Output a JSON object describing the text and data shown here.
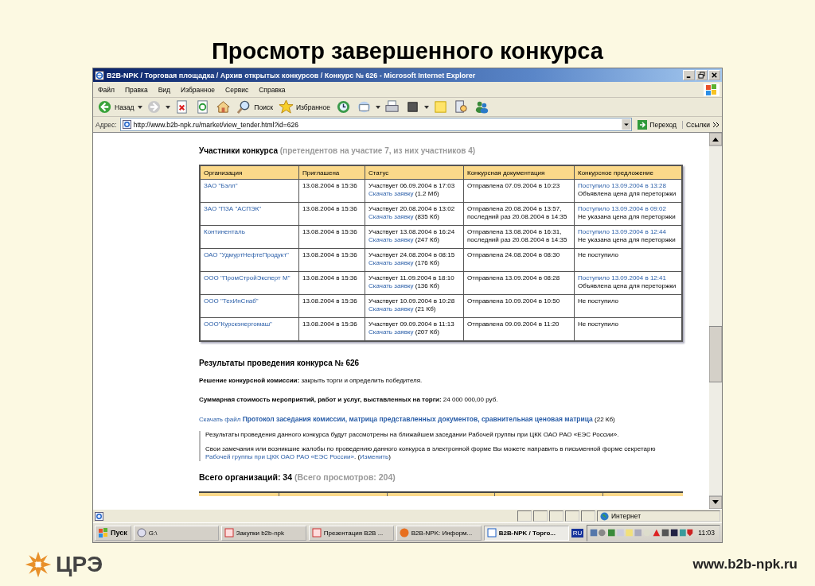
{
  "slide": {
    "title": "Просмотр завершенного конкурса",
    "logo_text": "ЦРЭ",
    "url": "www.b2b-npk.ru"
  },
  "browser": {
    "title": "B2B-NPK / Торговая площадка / Архив открытых конкурсов / Конкурс № 626 - Microsoft Internet Explorer",
    "menu": [
      "Файл",
      "Правка",
      "Вид",
      "Избранное",
      "Сервис",
      "Справка"
    ],
    "toolbar": [
      {
        "kind": "back",
        "label": "Назад",
        "dropdown": true
      },
      {
        "kind": "forward",
        "dropdown": true
      },
      {
        "kind": "stop",
        "dropdown": false
      },
      {
        "kind": "refresh",
        "dropdown": false
      },
      {
        "kind": "home",
        "dropdown": false
      },
      {
        "kind": "search",
        "label": "Поиск",
        "dropdown": false
      },
      {
        "kind": "favorites",
        "label": "Избранное",
        "dropdown": false
      },
      {
        "kind": "history",
        "dropdown": false
      },
      {
        "kind": "mail",
        "dropdown": true
      },
      {
        "kind": "print",
        "dropdown": false
      },
      {
        "kind": "edit",
        "dropdown": true
      },
      {
        "kind": "note",
        "dropdown": false
      },
      {
        "kind": "research",
        "dropdown": false
      },
      {
        "kind": "messenger",
        "dropdown": false
      }
    ],
    "address": {
      "label": "Адрес:",
      "value": "http://www.b2b-npk.ru/market/view_tender.html?id=626"
    },
    "go_label": "Переход",
    "links_label": "Ссылки",
    "status_zone": "Интернет"
  },
  "page": {
    "participants_heading": "Участники конкурса",
    "participants_note": "(претендентов на участие 7, из них участников 4)",
    "table": {
      "columns": [
        "Организация",
        "Приглашена",
        "Статус",
        "Конкурсная документация",
        "Конкурсное предложение"
      ],
      "rows": [
        {
          "org": "ЗАО \"Бэлл\"",
          "invited": "13.08.2004 в 15:36",
          "status": "Участвует 06.09.2004 в 17:03",
          "status_link": "Скачать заявку",
          "status_size": "(1.2 Мб)",
          "docs": [
            "Отправлена 07.09.2004 в 10:23"
          ],
          "offer_link": "Поступило 13.09.2004 в 13:28",
          "offer_text": "Объявлена цена для переторжки"
        },
        {
          "org": "ЗАО \"ПЗА \"АСПЭК\"",
          "invited": "13.08.2004 в 15:36",
          "status": "Участвует 20.08.2004 в 13:02",
          "status_link": "Скачать заявку",
          "status_size": "(835 Кб)",
          "docs": [
            "Отправлена 20.08.2004 в 13:57,",
            "последний раз 20.08.2004 в 14:35"
          ],
          "offer_link": "Поступило 13.09.2004 в 09:02",
          "offer_text": "Не указана цена для переторжки"
        },
        {
          "org": "Континенталь",
          "invited": "13.08.2004 в 15:36",
          "status": "Участвует 13.08.2004 в 16:24",
          "status_link": "Скачать заявку",
          "status_size": "(247 Кб)",
          "docs": [
            "Отправлена 13.08.2004 в 16:31,",
            "последний раз 20.08.2004 в 14:35"
          ],
          "offer_link": "Поступило 13.09.2004 в 12:44",
          "offer_text": "Не указана цена для переторжки"
        },
        {
          "org": "ОАО \"УдмуртНефтеПродукт\"",
          "invited": "13.08.2004 в 15:36",
          "status": "Участвует 24.08.2004 в 08:15",
          "status_link": "Скачать заявку",
          "status_size": "(176 Кб)",
          "docs": [
            "Отправлена 24.08.2004 в 08:30"
          ],
          "offer_text": "Не поступило"
        },
        {
          "org": "ООО \"ПромСтройЭксперт М\"",
          "invited": "13.08.2004 в 15:36",
          "status": "Участвует 11.09.2004 в 18:10",
          "status_link": "Скачать заявку",
          "status_size": "(136 Кб)",
          "docs": [
            "Отправлена 13.09.2004 в 08:28"
          ],
          "offer_link": "Поступило 13.09.2004 в 12:41",
          "offer_text": "Объявлена цена для переторжки"
        },
        {
          "org": "ООО \"ТехИнСнаб\"",
          "invited": "13.08.2004 в 15:36",
          "status": "Участвует 10.09.2004 в 10:28",
          "status_link": "Скачать заявку",
          "status_size": "(21 Кб)",
          "docs": [
            "Отправлена 10.09.2004 в 10:50"
          ],
          "offer_text": "Не поступило"
        },
        {
          "org": "ООО\"Курскэнергомаш\"",
          "invited": "13.08.2004 в 15:36",
          "status": "Участвует 09.09.2004 в 11:13",
          "status_link": "Скачать заявку",
          "status_size": "(207 Кб)",
          "docs": [
            "Отправлена 09.09.2004 в 11:20"
          ],
          "offer_text": "Не поступило"
        }
      ]
    },
    "results_heading": "Результаты проведения конкурса № 626",
    "decision": "**Решение конкурсной комиссии:** закрыть торги и определить победителя.",
    "total": "**Суммарная стоимость мероприятий, работ и услуг, выставленных на торги:** 24 000 000,00 руб.",
    "download_link": "Скачать файл",
    "download_file": "Протокол заседания комиссии, матрица представленных документов, сравнительная ценовая матрица",
    "download_size": "(22 Кб)",
    "note_1": "Результаты проведения данного конкурса будут рассмотрены на ближайшем заседании Рабочей группы при ЦКК ОАО РАО «ЕЭС России».",
    "note_2": "Свои замечания или возникшие жалобы по проведению данного конкурса в электронной форме Вы можете направить в письменной форме секретарю",
    "note_2_link": "Рабочей группы при ЦКК ОАО РАО «ЕЭС России»",
    "note_2_sep": ".",
    "note_2_open": "(",
    "note_2_edit": "Изменить",
    "note_2_close": ")",
    "orgs_label": "Всего организаций: 34",
    "orgs_note": "(Всего просмотров: 204)"
  },
  "taskbar": {
    "start": "Пуск",
    "items": [
      {
        "kind": "drive",
        "label": "G:\\",
        "selected": false
      },
      {
        "kind": "doc",
        "label": "Закупки b2b-npk",
        "selected": false
      },
      {
        "kind": "doc",
        "label": "Презентация B2B ...",
        "selected": false
      },
      {
        "kind": "firefox",
        "label": "B2B-NPK: Информ...",
        "selected": false
      },
      {
        "kind": "ie",
        "label": "B2B-NPK / Торго...",
        "selected": true
      }
    ],
    "lang": "RU",
    "clock": "11:03"
  }
}
